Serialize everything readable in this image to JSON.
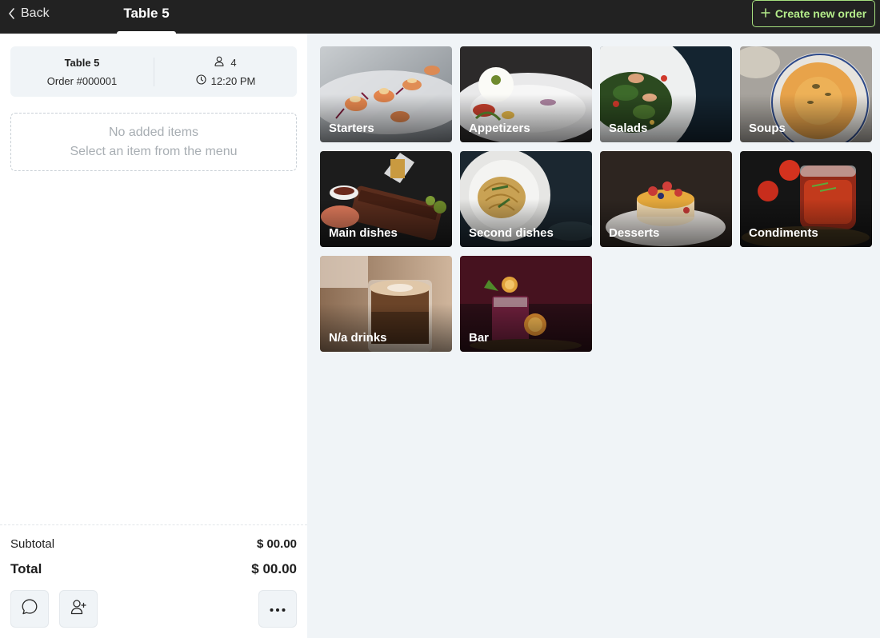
{
  "topbar": {
    "back_label": "Back",
    "tab_title": "Table 5",
    "create_label": "Create new order"
  },
  "order": {
    "table_name": "Table 5",
    "order_number": "Order #000001",
    "guests": "4",
    "time": "12:20 PM"
  },
  "empty_state": {
    "line1": "No added items",
    "line2": "Select an item from the menu"
  },
  "summary": {
    "subtotal_label": "Subtotal",
    "subtotal_value": "$ 00.00",
    "total_label": "Total",
    "total_value": "$ 00.00"
  },
  "categories": [
    {
      "label": "Starters",
      "icon": "starters-photo"
    },
    {
      "label": "Appetizers",
      "icon": "appetizers-photo"
    },
    {
      "label": "Salads",
      "icon": "salads-photo"
    },
    {
      "label": "Soups",
      "icon": "soups-photo"
    },
    {
      "label": "Main dishes",
      "icon": "main-dishes-photo"
    },
    {
      "label": "Second dishes",
      "icon": "second-dishes-photo"
    },
    {
      "label": "Desserts",
      "icon": "desserts-photo"
    },
    {
      "label": "Condiments",
      "icon": "condiments-photo"
    },
    {
      "label": "N/a drinks",
      "icon": "na-drinks-photo"
    },
    {
      "label": "Bar",
      "icon": "bar-photo"
    }
  ],
  "colors": {
    "topbar_bg": "#222222",
    "accent_green": "#a6e07e",
    "panel_bg": "#ffffff",
    "grid_bg": "#f0f4f7"
  }
}
